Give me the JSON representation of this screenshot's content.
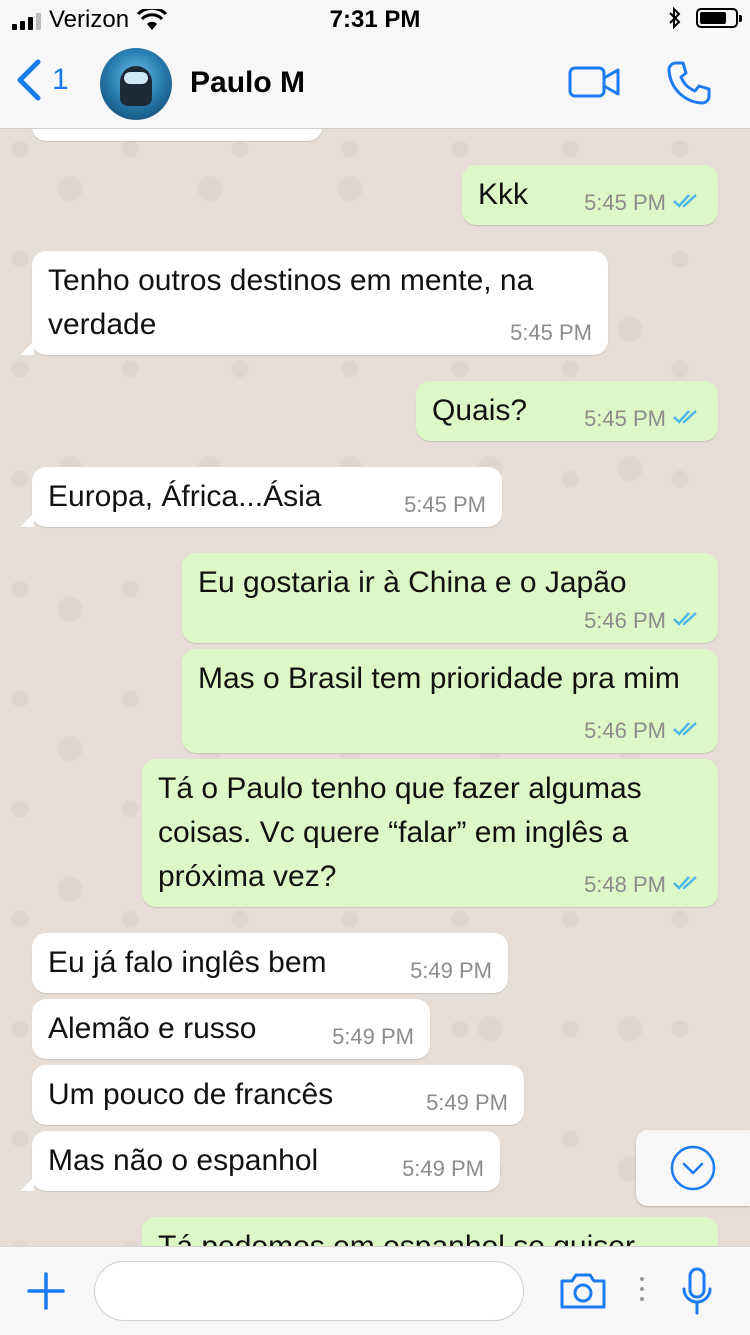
{
  "status_bar": {
    "carrier": "Verizon",
    "time": "7:31 PM",
    "battery_level": 0.75
  },
  "header": {
    "back_count": "1",
    "contact_name": "Paulo M",
    "icons": {
      "back": "chevron-left-icon",
      "video": "video-camera-icon",
      "call": "phone-icon"
    }
  },
  "messages": [
    {
      "direction": "out",
      "text": "Kkk",
      "time": "5:45 PM",
      "read": true
    },
    {
      "direction": "in",
      "text": "Tenho outros destinos em mente, na verdade",
      "time": "5:45 PM"
    },
    {
      "direction": "out",
      "text": "Quais?",
      "time": "5:45 PM",
      "read": true
    },
    {
      "direction": "in",
      "text": "Europa, África...Ásia",
      "time": "5:45 PM"
    },
    {
      "direction": "out",
      "text": "Eu gostaria ir à China e o Japão",
      "time": "5:46 PM",
      "read": true
    },
    {
      "direction": "out",
      "text": "Mas o Brasil tem prioridade pra mim",
      "time": "5:46 PM",
      "read": true
    },
    {
      "direction": "out",
      "text": "Tá o Paulo tenho que fazer algumas coisas. Vc quere “falar” em inglês a próxima vez?",
      "time": "5:48 PM",
      "read": true
    },
    {
      "direction": "in",
      "text": "Eu já falo inglês bem",
      "time": "5:49 PM"
    },
    {
      "direction": "in",
      "text": "Alemão e russo",
      "time": "5:49 PM"
    },
    {
      "direction": "in",
      "text": "Um pouco de francês",
      "time": "5:49 PM"
    },
    {
      "direction": "in",
      "text": "Mas não o espanhol",
      "time": "5:49 PM"
    },
    {
      "direction": "out",
      "text": "Tá podemos em espanhol se quiser",
      "time": "",
      "read": true
    }
  ],
  "input_bar": {
    "placeholder": "",
    "icons": {
      "add": "plus-icon",
      "camera": "camera-icon",
      "mic": "microphone-icon"
    }
  },
  "scroll_button": {
    "icon": "chevron-down-circle-icon"
  },
  "colors": {
    "accent": "#1a7bf2",
    "outgoing_bubble": "#dcf8c6",
    "incoming_bubble": "#ffffff",
    "read_ticks": "#4fb6ec",
    "chat_background": "#e6ded6"
  }
}
